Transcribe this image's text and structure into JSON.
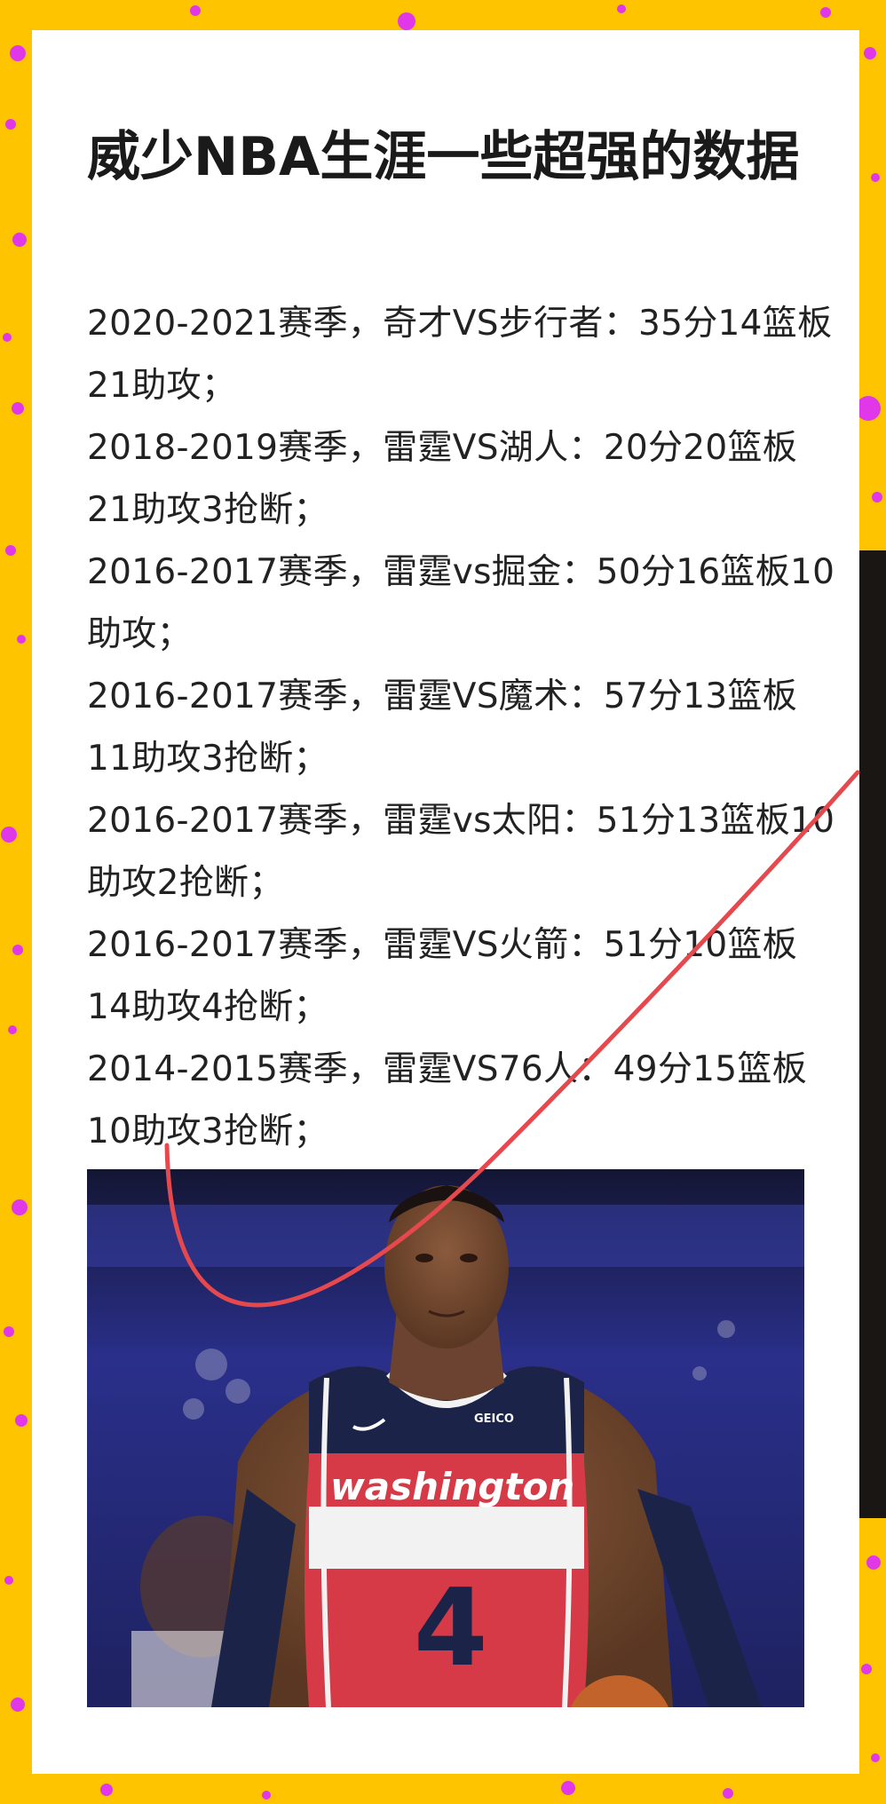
{
  "article": {
    "title": "威少NBA生涯一些超强的数据",
    "stats": [
      "2020-2021赛季，奇才VS步行者：35分14篮板21助攻；",
      "2018-2019赛季，雷霆VS湖人：20分20篮板21助攻3抢断；",
      "2016-2017赛季，雷霆vs掘金：50分16篮板10助攻；",
      "2016-2017赛季，雷霆VS魔术：57分13篮板11助攻3抢断；",
      "2016-2017赛季，雷霆vs太阳：51分13篮板10助攻2抢断；",
      "2016-2017赛季，雷霆VS火箭：51分10篮板14助攻4抢断；",
      "2014-2015赛季，雷霆VS76人：49分15篮板10助攻3抢断；"
    ]
  },
  "photo": {
    "jersey_wordmark": "washington",
    "jersey_number": "4",
    "sponsor": "GEICO",
    "jersey_colors": {
      "red": "#d53a46",
      "navy": "#1b2448",
      "white": "#f2f2f2"
    }
  },
  "decor": {
    "background_color": "#ffc400",
    "dot_color": "#e038e8",
    "annotation_color": "#e5484d"
  }
}
